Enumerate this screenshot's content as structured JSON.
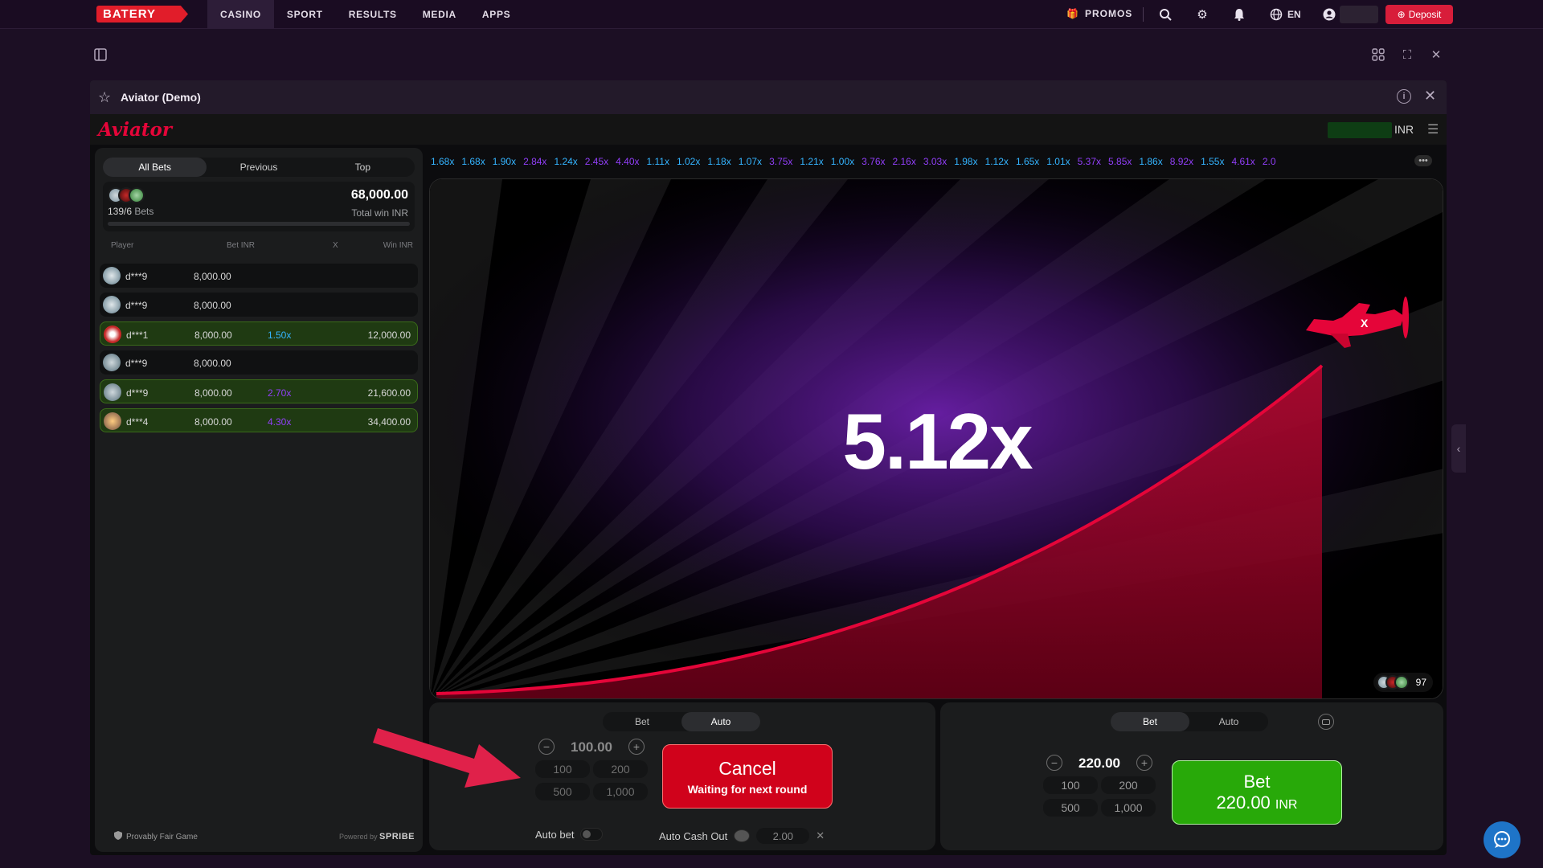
{
  "topnav": {
    "logo": "BATERY",
    "items": [
      "CASINO",
      "SPORT",
      "RESULTS",
      "MEDIA",
      "APPS"
    ],
    "active": "CASINO",
    "promos": "PROMOS",
    "lang": "EN",
    "deposit": "Deposit"
  },
  "game": {
    "title": "Aviator (Demo)",
    "brand": "Aviator",
    "currency": "INR"
  },
  "bets_panel": {
    "tabs": [
      "All Bets",
      "Previous",
      "Top"
    ],
    "active_tab": "All Bets",
    "bets_count": "139/6",
    "bets_label": "Bets",
    "total_win": "68,000.00",
    "total_win_label": "Total win INR",
    "columns": [
      "Player",
      "Bet INR",
      "X",
      "Win INR"
    ],
    "rows": [
      {
        "player": "d***9",
        "bet": "8,000.00",
        "mult": "",
        "win": "",
        "won": false
      },
      {
        "player": "d***9",
        "bet": "8,000.00",
        "mult": "",
        "win": "",
        "won": false
      },
      {
        "player": "d***1",
        "bet": "8,000.00",
        "mult": "1.50x",
        "win": "12,000.00",
        "won": true
      },
      {
        "player": "d***9",
        "bet": "8,000.00",
        "mult": "",
        "win": "",
        "won": false
      },
      {
        "player": "d***9",
        "bet": "8,000.00",
        "mult": "2.70x",
        "win": "21,600.00",
        "won": true
      },
      {
        "player": "d***4",
        "bet": "8,000.00",
        "mult": "4.30x",
        "win": "34,400.00",
        "won": true
      }
    ],
    "fair": "Provably Fair Game",
    "powered_by": "Powered by",
    "powered_brand": "SPRIBE"
  },
  "history": [
    "1.68x",
    "1.68x",
    "1.90x",
    "2.84x",
    "1.24x",
    "2.45x",
    "4.40x",
    "1.11x",
    "1.02x",
    "1.18x",
    "1.07x",
    "3.75x",
    "1.21x",
    "1.00x",
    "3.76x",
    "2.16x",
    "3.03x",
    "1.98x",
    "1.12x",
    "1.65x",
    "1.01x",
    "5.37x",
    "5.85x",
    "1.86x",
    "8.92x",
    "1.55x",
    "4.61x",
    "2.0"
  ],
  "flight": {
    "multiplier": "5.12x",
    "watchers": "97"
  },
  "bet1": {
    "tabs": [
      "Bet",
      "Auto"
    ],
    "active_tab": "Auto",
    "amount": "100.00",
    "quick": [
      "100",
      "200",
      "500",
      "1,000"
    ],
    "cancel": "Cancel",
    "cancel_sub": "Waiting for next round",
    "auto_bet": "Auto bet",
    "auto_cashout": "Auto Cash Out",
    "cashout_value": "2.00"
  },
  "bet2": {
    "tabs": [
      "Bet",
      "Auto"
    ],
    "active_tab": "Bet",
    "amount": "220.00",
    "quick": [
      "100",
      "200",
      "500",
      "1,000"
    ],
    "bet_label": "Bet",
    "bet_amount": "220.00",
    "bet_currency": "INR"
  },
  "colors": {
    "accent": "#d81d3a",
    "win_green": "#28a909",
    "cancel_red": "#d0021b",
    "mult_blue": "#34b4ff",
    "mult_purple": "#913ef8",
    "mult_pink": "#c017b4"
  }
}
